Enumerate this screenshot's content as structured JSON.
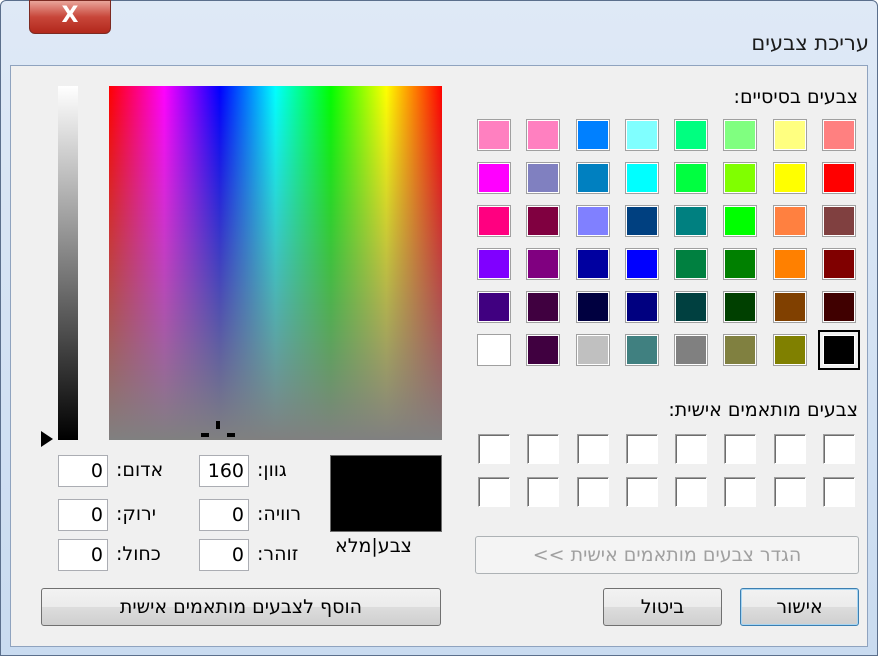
{
  "window": {
    "title": "עריכת צבעים",
    "close_symbol": "X"
  },
  "basic": {
    "label": "צבעים בסיסיים:",
    "rows": [
      [
        "#ff80c0",
        "#ff80c0",
        "#0080ff",
        "#80ffff",
        "#00ff80",
        "#80ff80",
        "#ffff80",
        "#ff8080"
      ],
      [
        "#ff00ff",
        "#8080c0",
        "#0080c0",
        "#00ffff",
        "#00ff40",
        "#80ff00",
        "#ffff00",
        "#ff0000"
      ],
      [
        "#ff0080",
        "#800040",
        "#8080ff",
        "#004080",
        "#008080",
        "#00ff00",
        "#ff8040",
        "#804040"
      ],
      [
        "#8000ff",
        "#800080",
        "#0000a0",
        "#0000ff",
        "#008040",
        "#008000",
        "#ff8000",
        "#800000"
      ],
      [
        "#400080",
        "#400040",
        "#000040",
        "#000080",
        "#004040",
        "#004000",
        "#804000",
        "#400000"
      ],
      [
        "#ffffff",
        "#400040",
        "#c0c0c0",
        "#408080",
        "#808080",
        "#808040",
        "#808000",
        "#000000"
      ]
    ],
    "selected_color": "#000000"
  },
  "custom": {
    "label": "צבעים מותאמים אישית:"
  },
  "define_button": "הגדר צבעים מותאמים אישית >>",
  "ok_button": "אישור",
  "cancel_button": "ביטול",
  "add_button": "הוסף לצבעים מותאמים אישית",
  "solid_label": "צבע|מלא",
  "solid_color": "#000000",
  "fields": {
    "hue_label": "גוון:",
    "hue": "160",
    "sat_label": "רוויה:",
    "sat": "0",
    "lum_label": "זוהר:",
    "lum": "0",
    "red_label": "אדום:",
    "red": "0",
    "green_label": "ירוק:",
    "green": "0",
    "blue_label": "כחול:",
    "blue": "0"
  }
}
